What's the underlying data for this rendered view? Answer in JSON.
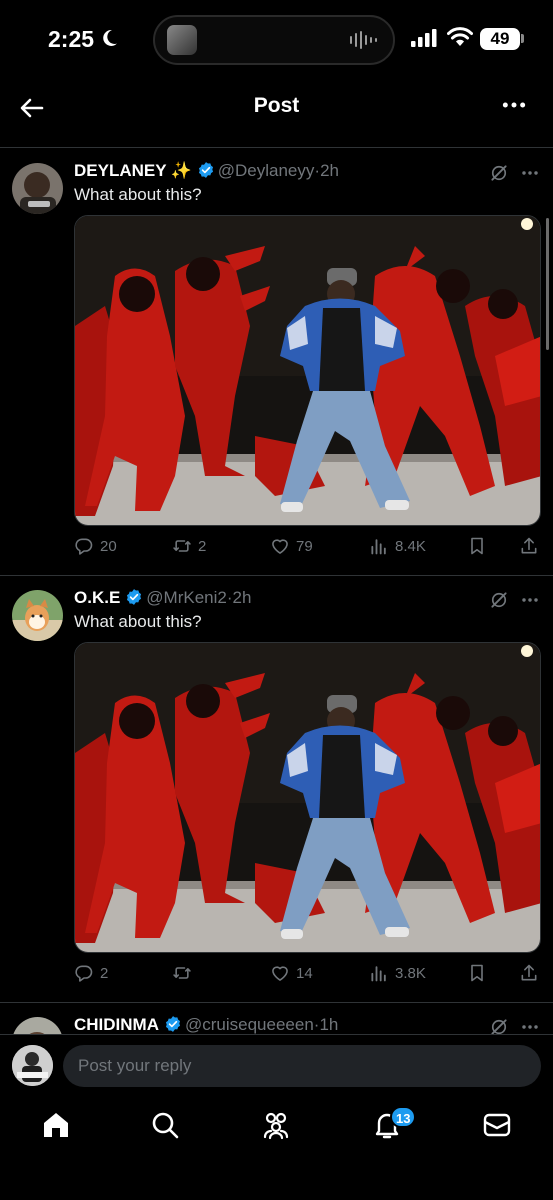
{
  "status_bar": {
    "time": "2:25",
    "battery": "49"
  },
  "header": {
    "title": "Post"
  },
  "posts": [
    {
      "name": "DEYLANEY",
      "emoji": "✨",
      "handle": "@Deylaneyy",
      "separator": "·",
      "time_ago": "2h",
      "text": "What about this?",
      "replies": "20",
      "reposts": "2",
      "likes": "79",
      "views": "8.4K"
    },
    {
      "name": "O.K.E",
      "emoji": "",
      "handle": "@MrKeni2",
      "separator": "·",
      "time_ago": "2h",
      "text": "What about this?",
      "replies": "2",
      "reposts": "",
      "likes": "14",
      "views": "3.8K"
    },
    {
      "name": "CHIDINMA",
      "emoji": "",
      "handle": "@cruisequeeeen",
      "separator": "·",
      "time_ago": "1h",
      "text": ""
    }
  ],
  "reply": {
    "placeholder": "Post your reply"
  },
  "nav": {
    "notification_count": "13"
  },
  "colors": {
    "accent": "#1d9bf0",
    "background": "#000000",
    "muted": "#71767b",
    "stage_red": "#c21a12"
  },
  "icons": {
    "header": [
      "back-arrow-icon",
      "more-icon"
    ],
    "post": [
      "verified-badge-icon",
      "grok-icon",
      "more-icon",
      "reply-icon",
      "repost-icon",
      "like-icon",
      "views-icon",
      "bookmark-icon",
      "share-icon"
    ],
    "nav": [
      "home-icon",
      "search-icon",
      "communities-icon",
      "notifications-icon",
      "messages-icon"
    ]
  }
}
